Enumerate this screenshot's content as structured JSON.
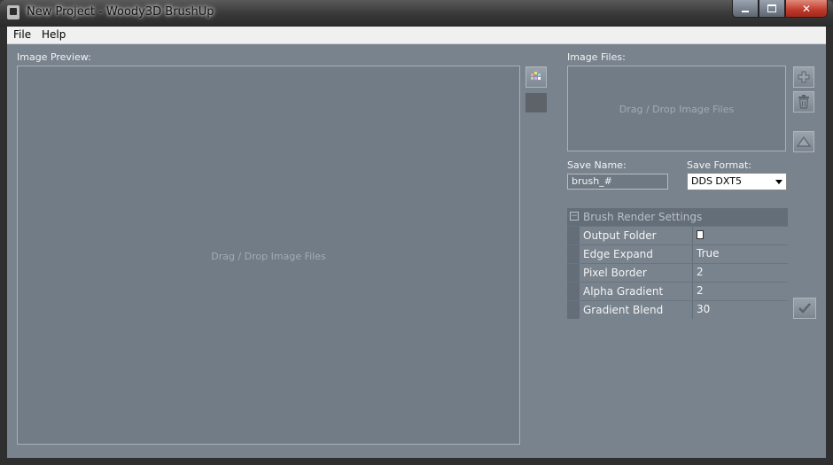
{
  "window": {
    "title": "New Project - Woody3D BrushUp"
  },
  "menu": {
    "items": [
      "File",
      "Help"
    ]
  },
  "preview": {
    "label": "Image Preview:",
    "hint": "Drag / Drop Image Files"
  },
  "files": {
    "label": "Image Files:",
    "hint": "Drag / Drop Image Files"
  },
  "save": {
    "name_label": "Save Name:",
    "name_value": "brush_#",
    "format_label": "Save Format:",
    "format_value": "DDS DXT5"
  },
  "settings": {
    "header": "Brush Render Settings",
    "rows": [
      {
        "key": "Output Folder",
        "value": ""
      },
      {
        "key": "Edge Expand",
        "value": "True"
      },
      {
        "key": "Pixel Border",
        "value": "2"
      },
      {
        "key": "Alpha Gradient",
        "value": "2"
      },
      {
        "key": "Gradient Blend",
        "value": "30"
      }
    ]
  },
  "icons": {
    "app": "app-icon",
    "palette": "color-palette-icon",
    "add": "plus-icon",
    "delete": "trash-icon",
    "warning": "warning-triangle-icon",
    "render": "checkmark-icon",
    "folder": "folder-icon"
  }
}
